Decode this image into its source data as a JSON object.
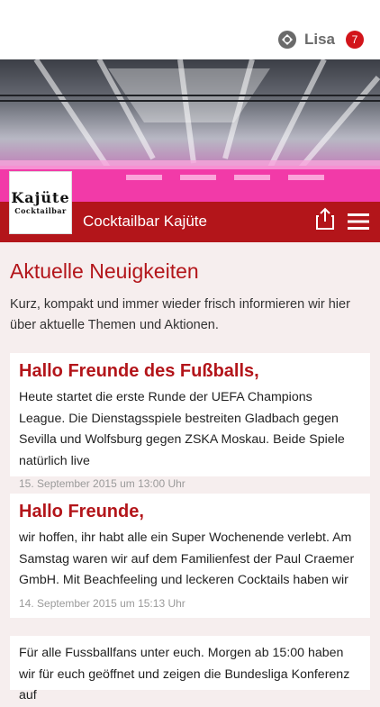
{
  "user": {
    "name": "Lisa",
    "notifications": "7",
    "icon": "user-avatar-icon"
  },
  "header": {
    "logo_line1": "Kajüte",
    "logo_line2": "Cocktailbar",
    "title": "Cocktailbar Kajüte",
    "share_icon": "share-icon",
    "menu_icon": "menu-icon"
  },
  "main": {
    "title": "Aktuelle Neuigkeiten",
    "intro": "Kurz, kompakt und immer wieder frisch informieren wir hier über aktuelle Themen und Aktionen."
  },
  "news": [
    {
      "title": "Hallo Freunde des Fußballs,",
      "text": "Heute startet die erste Runde der UEFA Champions League. Die Dienstagsspiele bestreiten Gladbach gegen Sevilla und Wolfsburg gegen ZSKA Moskau. Beide Spiele natürlich live",
      "date": "15. September 2015 um 13:00 Uhr"
    },
    {
      "title": "Hallo Freunde,",
      "text": "wir hoffen, ihr habt alle ein Super Wochenende verlebt. Am Samstag waren wir auf dem Familienfest der Paul Craemer GmbH. Mit Beachfeeling und leckeren Cocktails haben wir",
      "date": "14. September 2015 um 15:13 Uhr"
    },
    {
      "title": "",
      "text": "Für alle Fussballfans unter euch. Morgen ab 15:00 haben wir für euch geöffnet und zeigen die Bundesliga Konferenz auf",
      "date": ""
    }
  ],
  "colors": {
    "accent": "#b3151a",
    "background": "#f6eeee"
  }
}
